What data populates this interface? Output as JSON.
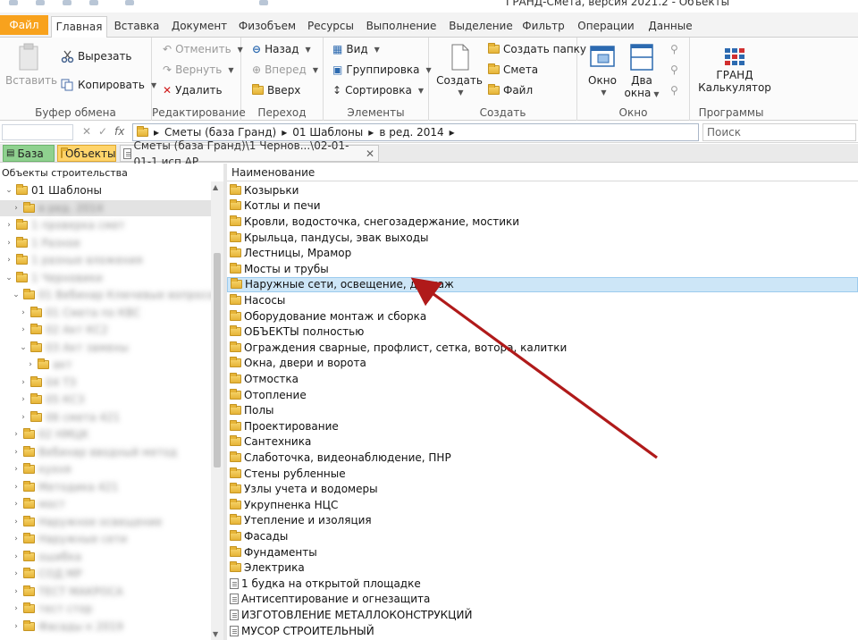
{
  "window": {
    "title": "ГРАНД-Смета, версия 2021.2 - Объекты"
  },
  "tabs": [
    "Файл",
    "Главная",
    "Вставка",
    "Документ",
    "Физобъем",
    "Ресурсы",
    "Выполнение",
    "Выделение",
    "Фильтр",
    "Операции",
    "Данные"
  ],
  "ribbon": {
    "clipboard": {
      "paste": "Вставить",
      "cut": "Вырезать",
      "copy": "Копировать",
      "label": "Буфер обмена"
    },
    "edit": {
      "undo": "Отменить",
      "redo": "Вернуть",
      "delete": "Удалить",
      "label": "Редактирование"
    },
    "nav": {
      "back": "Назад",
      "forward": "Вперед",
      "up": "Вверх",
      "label": "Переход"
    },
    "elements": {
      "view": "Вид",
      "group": "Группировка",
      "sort": "Сортировка",
      "label": "Элементы"
    },
    "create": {
      "create": "Создать",
      "new_folder": "Создать папку",
      "estimate": "Смета",
      "file": "Файл",
      "label": "Создать"
    },
    "window": {
      "window": "Окно",
      "two_windows_1": "Два",
      "two_windows_2": "окна",
      "label": "Окно"
    },
    "programs": {
      "grand": "ГРАНД",
      "calc": "Калькулятор",
      "label": "Программы"
    }
  },
  "address": {
    "path": [
      "Сметы (база Гранд)",
      "01 Шаблоны",
      "в ред. 2014"
    ],
    "search_placeholder": "Поиск"
  },
  "doc_tabs": {
    "base": "База",
    "objects": "Объекты",
    "doc": "Сметы (база Гранд)\\1 Чернов...\\02-01-01-1 исп АР"
  },
  "tree": {
    "title": "Объекты строительства",
    "items": [
      {
        "label": "01 Шаблоны",
        "level": 1,
        "expanded": true
      },
      {
        "label": "в ред. 2014",
        "level": 2,
        "selected": true,
        "blurred": true
      },
      {
        "label": "1 проверка смет",
        "level": 1,
        "blurred": true
      },
      {
        "label": "1 Разное",
        "level": 1,
        "blurred": true
      },
      {
        "label": "1 разные вложения",
        "level": 1,
        "blurred": true
      },
      {
        "label": "1 Черновики",
        "level": 1,
        "expanded": true,
        "blurred": true
      },
      {
        "label": "01 Вебинар Ключевые вопросов",
        "level": 2,
        "expanded": true,
        "blurred": true
      },
      {
        "label": "01 Смета по КВС",
        "level": 3,
        "blurred": true
      },
      {
        "label": "02 Акт КС2",
        "level": 3,
        "blurred": true
      },
      {
        "label": "03 Акт замены",
        "level": 3,
        "expanded": true,
        "blurred": true
      },
      {
        "label": "акт",
        "level": 4,
        "blurred": true
      },
      {
        "label": "04 ТЗ",
        "level": 3,
        "blurred": true
      },
      {
        "label": "05 КС3",
        "level": 3,
        "blurred": true
      },
      {
        "label": "06 смета 421",
        "level": 3,
        "blurred": true
      },
      {
        "label": "02 НМЦК",
        "level": 2,
        "blurred": true
      },
      {
        "label": "Вебинар вводный метод",
        "level": 2,
        "blurred": true
      },
      {
        "label": "кухня",
        "level": 2,
        "blurred": true
      },
      {
        "label": "Методика 421",
        "level": 2,
        "blurred": true
      },
      {
        "label": "мост",
        "level": 2,
        "blurred": true
      },
      {
        "label": "Наружное освещение",
        "level": 2,
        "blurred": true
      },
      {
        "label": "Наружные сети",
        "level": 2,
        "blurred": true
      },
      {
        "label": "ошибка",
        "level": 2,
        "blurred": true
      },
      {
        "label": "СОД МР",
        "level": 2,
        "blurred": true
      },
      {
        "label": "ТЕСТ МАКРОСА",
        "level": 2,
        "blurred": true
      },
      {
        "label": "тест стор",
        "level": 2,
        "blurred": true
      },
      {
        "label": "Фасады к 2019",
        "level": 2,
        "blurred": true
      }
    ]
  },
  "list": {
    "header": "Наименование",
    "rows": [
      {
        "label": "Козырьки",
        "type": "folder"
      },
      {
        "label": "Котлы и печи",
        "type": "folder"
      },
      {
        "label": "Кровли, водосточка, снегозадержание, мостики",
        "type": "folder"
      },
      {
        "label": "Крыльца, пандусы, эвак выходы",
        "type": "folder"
      },
      {
        "label": "Лестницы, Мрамор",
        "type": "folder"
      },
      {
        "label": "Мосты и трубы",
        "type": "folder"
      },
      {
        "label": "Наружные сети, освещение, дренаж",
        "type": "folder",
        "selected": true
      },
      {
        "label": "Насосы",
        "type": "folder"
      },
      {
        "label": "Оборудование монтаж и сборка",
        "type": "folder"
      },
      {
        "label": "ОБЪЕКТЫ полностью",
        "type": "folder"
      },
      {
        "label": "Ограждения сварные, профлист, сетка, вотора, калитки",
        "type": "folder"
      },
      {
        "label": "Окна, двери и ворота",
        "type": "folder"
      },
      {
        "label": "Отмостка",
        "type": "folder"
      },
      {
        "label": "Отопление",
        "type": "folder"
      },
      {
        "label": "Полы",
        "type": "folder"
      },
      {
        "label": "Проектирование",
        "type": "folder"
      },
      {
        "label": "Сантехника",
        "type": "folder"
      },
      {
        "label": "Слаботочка, видеонаблюдение, ПНР",
        "type": "folder"
      },
      {
        "label": "Стены рубленные",
        "type": "folder"
      },
      {
        "label": "Узлы учета и водомеры",
        "type": "folder"
      },
      {
        "label": "Укрупненка НЦС",
        "type": "folder"
      },
      {
        "label": "Утепление и изоляция",
        "type": "folder"
      },
      {
        "label": "Фасады",
        "type": "folder"
      },
      {
        "label": "Фундаменты",
        "type": "folder"
      },
      {
        "label": "Электрика",
        "type": "folder"
      },
      {
        "label": "1 будка на открытой площадке",
        "type": "doc"
      },
      {
        "label": "Антисептирование и огнезащита",
        "type": "doc"
      },
      {
        "label": "ИЗГОТОВЛЕНИЕ МЕТАЛЛОКОНСТРУКЦИЙ",
        "type": "doc"
      },
      {
        "label": "МУСОР СТРОИТЕЛЬНЫЙ",
        "type": "doc"
      }
    ]
  },
  "colors": {
    "file_tab": "#f8a21d",
    "selection": "#cde6f7",
    "arrow": "#b01a1a",
    "base_tab": "#8fd18f",
    "objects_tab": "#ffd46a"
  }
}
